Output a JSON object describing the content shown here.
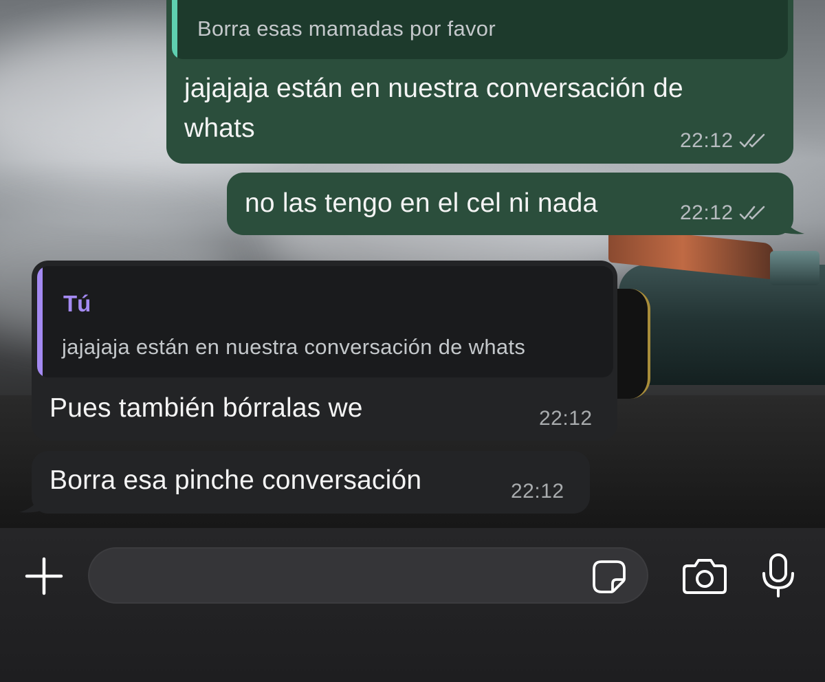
{
  "conversation": {
    "messages": [
      {
        "direction": "outgoing",
        "quote": {
          "text": "Borra esas mamadas por favor",
          "bar_color": "#5fcfb0"
        },
        "text_lines": [
          "jajajaja están en nuestra conversación de",
          "whats"
        ],
        "time": "22:12",
        "status_icon": "double-check-read-icon"
      },
      {
        "direction": "outgoing",
        "text_lines": [
          "no las tengo en el cel ni nada"
        ],
        "time": "22:12",
        "status_icon": "double-check-read-icon"
      },
      {
        "direction": "incoming",
        "quote": {
          "author": "Tú",
          "text": "jajajaja están en nuestra conversación de whats",
          "bar_color": "#a48af2"
        },
        "text_lines": [
          "Pues también bórralas we"
        ],
        "time": "22:12"
      },
      {
        "direction": "incoming",
        "text_lines": [
          "Borra esa pinche conversación"
        ],
        "time": "22:12"
      }
    ]
  },
  "composer": {
    "placeholder": "",
    "left_icon": "plus-icon",
    "field_icon": "sticker-icon",
    "right_icons": [
      "camera-icon",
      "microphone-icon"
    ]
  },
  "colors": {
    "outgoing_bubble": "#2b4e3c",
    "incoming_bubble": "#232426",
    "reply_author": "#a48af2",
    "reply_bar_outgoing": "#5fcfb0"
  }
}
